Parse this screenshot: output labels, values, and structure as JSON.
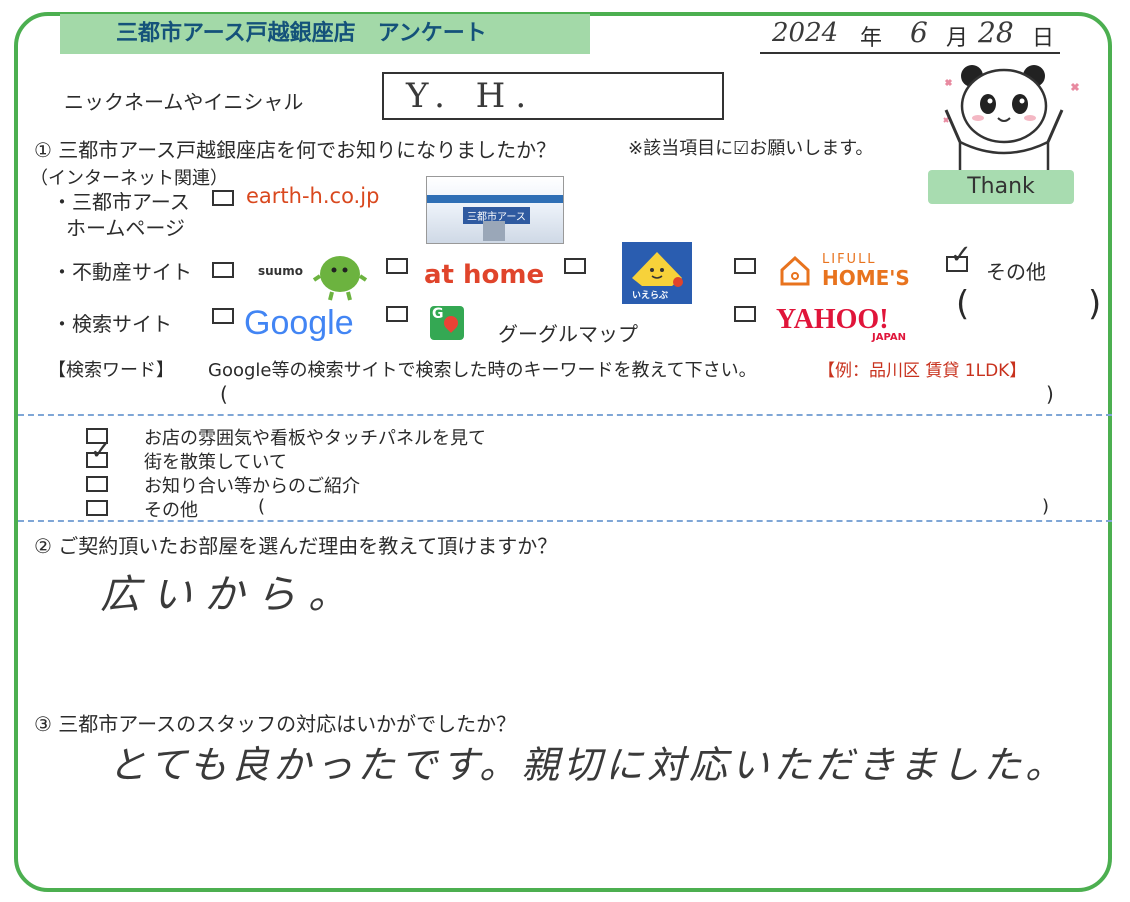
{
  "header": {
    "title": "三都市アース戸越銀座店　アンケート",
    "date_year": "2024",
    "year_kanji": "年",
    "date_month": "6",
    "month_kanji": "月",
    "date_day": "28",
    "day_kanji": "日"
  },
  "nickname": {
    "label": "ニックネームやイニシャル",
    "value": "Y. H."
  },
  "mascot": {
    "caption": "Thank"
  },
  "q1": {
    "question": "①  三都市アース戸越銀座店を何でお知りになりましたか？",
    "instruction": "※該当項目に☑お願いします。",
    "internet_group": "（インターネット関連）",
    "homepage_label_1": "・三都市アース",
    "homepage_label_2": "ホームページ",
    "homepage_url": "earth-h.co.jp",
    "thumb_text": "三都市アース",
    "realestate_label": "・不動産サイト",
    "suumo": "suumo",
    "athome": "at home",
    "ieraba": "いえらぶ",
    "lifull_top": "LIFULL",
    "lifull_bottom": "HOME'S",
    "other_label": "その他",
    "paren_open": "(",
    "paren_close": ")",
    "search_label": "・検索サイト",
    "google": "Google",
    "googlemap_badge": "G",
    "googlemap": "グーグルマップ",
    "yahoo": "YAHOO!",
    "yahoo_sub": "JAPAN",
    "keyword_label": "【検索ワード】",
    "keyword_text": "Google等の検索サイトで検索した時のキーワードを教えて下さい。",
    "keyword_example": "【例：品川区 賃貸 1LDK】",
    "kw_open": "(",
    "kw_close": ")"
  },
  "q1b": {
    "items": [
      {
        "label": "お店の雰囲気や看板やタッチパネルを見て"
      },
      {
        "label": "街を散策していて"
      },
      {
        "label": "お知り合い等からのご紹介"
      },
      {
        "label": "その他"
      }
    ],
    "other_open": "(",
    "other_close": ")"
  },
  "q2": {
    "question": "②  ご契約頂いたお部屋を選んだ理由を教えて頂けますか？",
    "answer": "広いから。"
  },
  "q3": {
    "question": "③  三都市アースのスタッフの対応はいかがでしたか？",
    "answer": "とても良かったです。親切に対応いただきました。"
  },
  "colors": {
    "frame": "#4caf50",
    "title_band": "#a3d9a8",
    "title_text": "#14527a",
    "dashed": "#7fa6d6",
    "example_red": "#c8321e"
  }
}
